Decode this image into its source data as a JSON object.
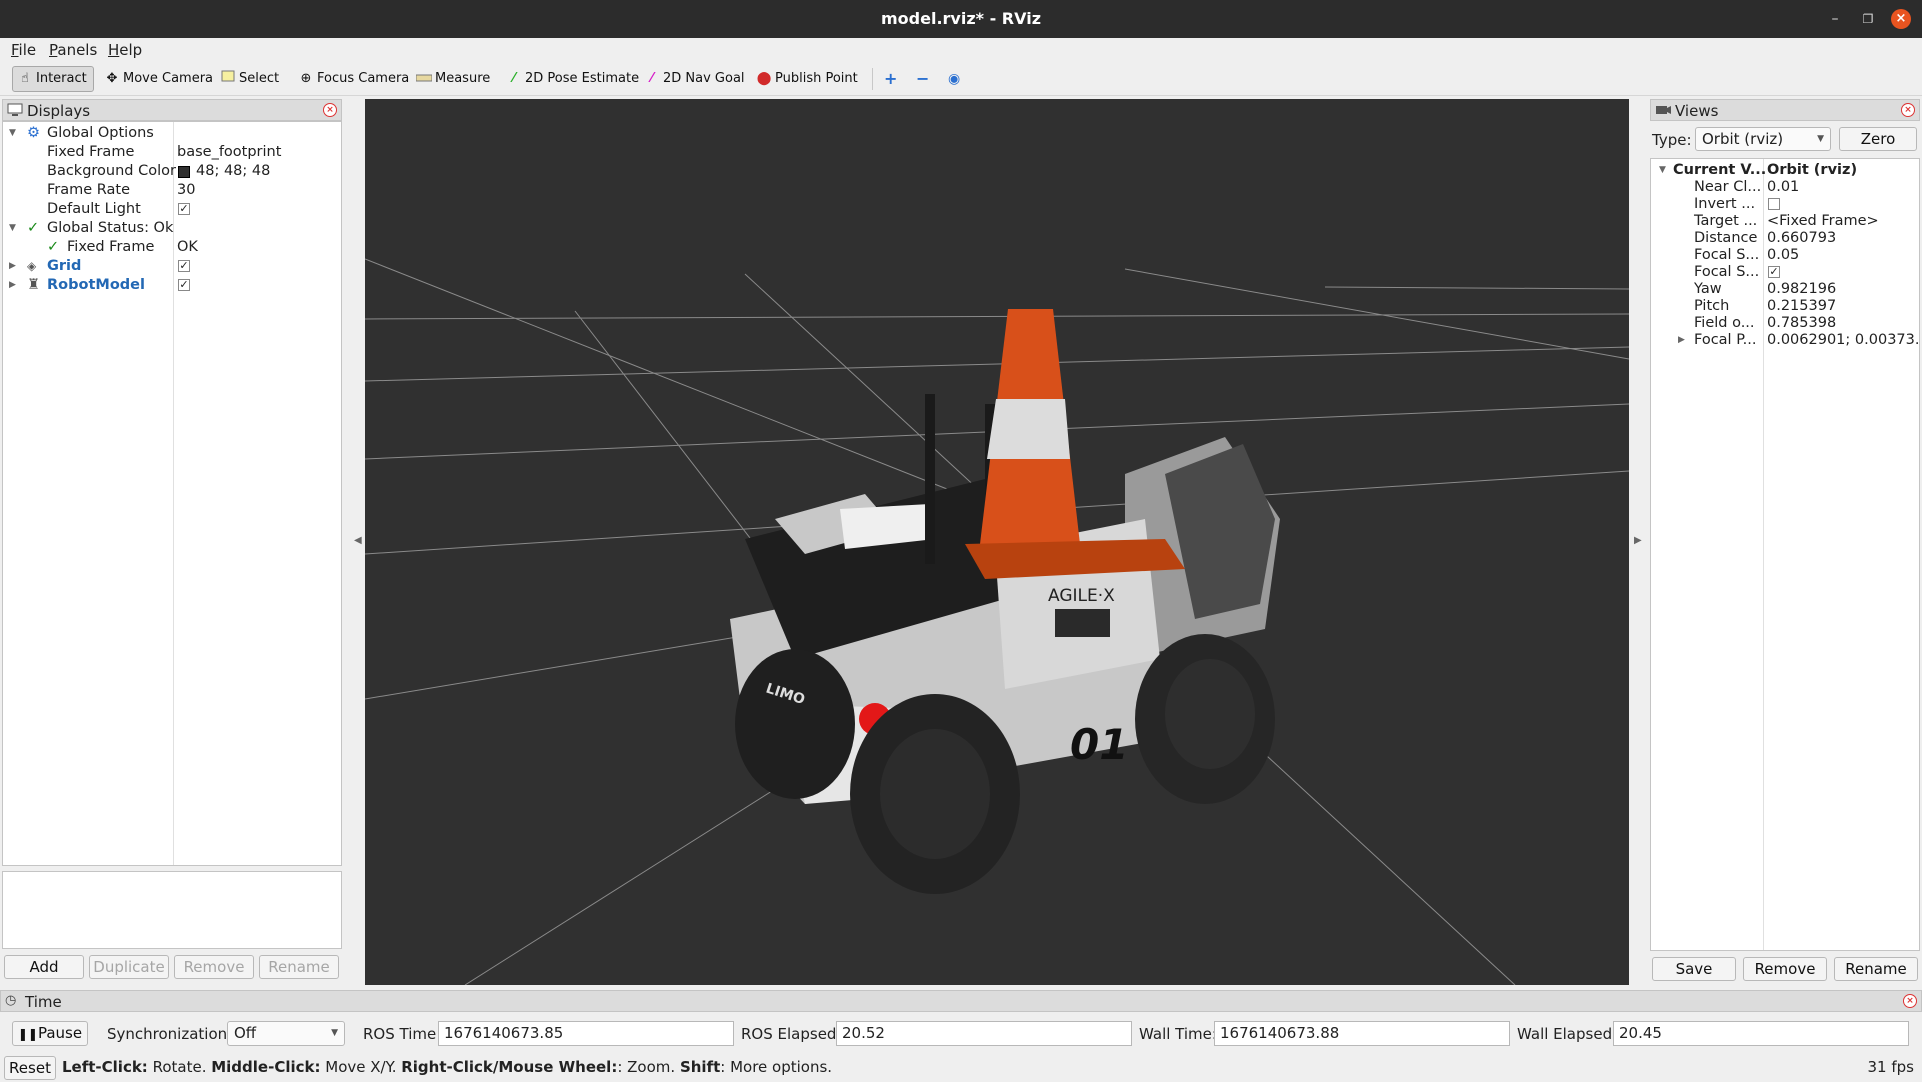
{
  "window": {
    "title": "model.rviz* - RViz"
  },
  "menu": [
    "File",
    "Panels",
    "Help"
  ],
  "toolbar": {
    "tools": [
      {
        "label": "Interact",
        "icon": "interact-icon",
        "active": true
      },
      {
        "label": "Move Camera",
        "icon": "move-camera-icon"
      },
      {
        "label": "Select",
        "icon": "select-icon"
      },
      {
        "label": "Focus Camera",
        "icon": "focus-camera-icon"
      },
      {
        "label": "Measure",
        "icon": "measure-icon"
      },
      {
        "label": "2D Pose Estimate",
        "icon": "pose-estimate-icon",
        "color": "#2bb02b"
      },
      {
        "label": "2D Nav Goal",
        "icon": "nav-goal-icon",
        "color": "#d61ec8"
      },
      {
        "label": "Publish Point",
        "icon": "publish-point-icon",
        "color": "#d12a2a"
      }
    ]
  },
  "displays": {
    "title": "Displays",
    "global_options": "Global Options",
    "fixed_frame_label": "Fixed Frame",
    "fixed_frame_value": "base_footprint",
    "background_color_label": "Background Color",
    "background_color_value": "48; 48; 48",
    "background_color_swatch": "#303030",
    "frame_rate_label": "Frame Rate",
    "frame_rate_value": "30",
    "default_light_label": "Default Light",
    "global_status": "Global Status: Ok",
    "status_fixed_frame": "Fixed Frame",
    "status_fixed_frame_value": "OK",
    "grid": "Grid",
    "robot_model": "RobotModel",
    "buttons": {
      "add": "Add",
      "duplicate": "Duplicate",
      "remove": "Remove",
      "rename": "Rename"
    }
  },
  "views": {
    "title": "Views",
    "type_label": "Type:",
    "type_value": "Orbit (rviz)",
    "zero": "Zero",
    "current_label": "Current V...",
    "current_value": "Orbit (rviz)",
    "props": [
      {
        "name": "Near Cl...",
        "value": "0.01"
      },
      {
        "name": "Invert ...",
        "value": "",
        "checkbox": false
      },
      {
        "name": "Target ...",
        "value": "<Fixed Frame>"
      },
      {
        "name": "Distance",
        "value": "0.660793"
      },
      {
        "name": "Focal S...",
        "value": "0.05"
      },
      {
        "name": "Focal S...",
        "value": "",
        "checkbox": true
      },
      {
        "name": "Yaw",
        "value": "0.982196"
      },
      {
        "name": "Pitch",
        "value": "0.215397"
      },
      {
        "name": "Field o...",
        "value": "0.785398"
      },
      {
        "name": "Focal P...",
        "value": "0.0062901; 0.00373..."
      }
    ],
    "buttons": {
      "save": "Save",
      "remove": "Remove",
      "rename": "Rename"
    }
  },
  "time": {
    "title": "Time",
    "pause": "Pause",
    "sync_label": "Synchronization:",
    "sync_value": "Off",
    "ros_time_label": "ROS Time:",
    "ros_time": "1676140673.85",
    "ros_elapsed_label": "ROS Elapsed:",
    "ros_elapsed": "20.52",
    "wall_time_label": "Wall Time:",
    "wall_time": "1676140673.88",
    "wall_elapsed_label": "Wall Elapsed:",
    "wall_elapsed": "20.45"
  },
  "status": {
    "reset": "Reset",
    "lc": "Left-Click:",
    "lc_t": " Rotate. ",
    "mc": "Middle-Click:",
    "mc_t": " Move X/Y. ",
    "rc": "Right-Click/Mouse Wheel:",
    "rc_t": ": Zoom. ",
    "sh": "Shift",
    "sh_t": ": More options.",
    "fps": "31 fps"
  },
  "scene": {
    "logo_text": "AGILE·X",
    "number_text": "01",
    "side_text": "LIMO"
  }
}
